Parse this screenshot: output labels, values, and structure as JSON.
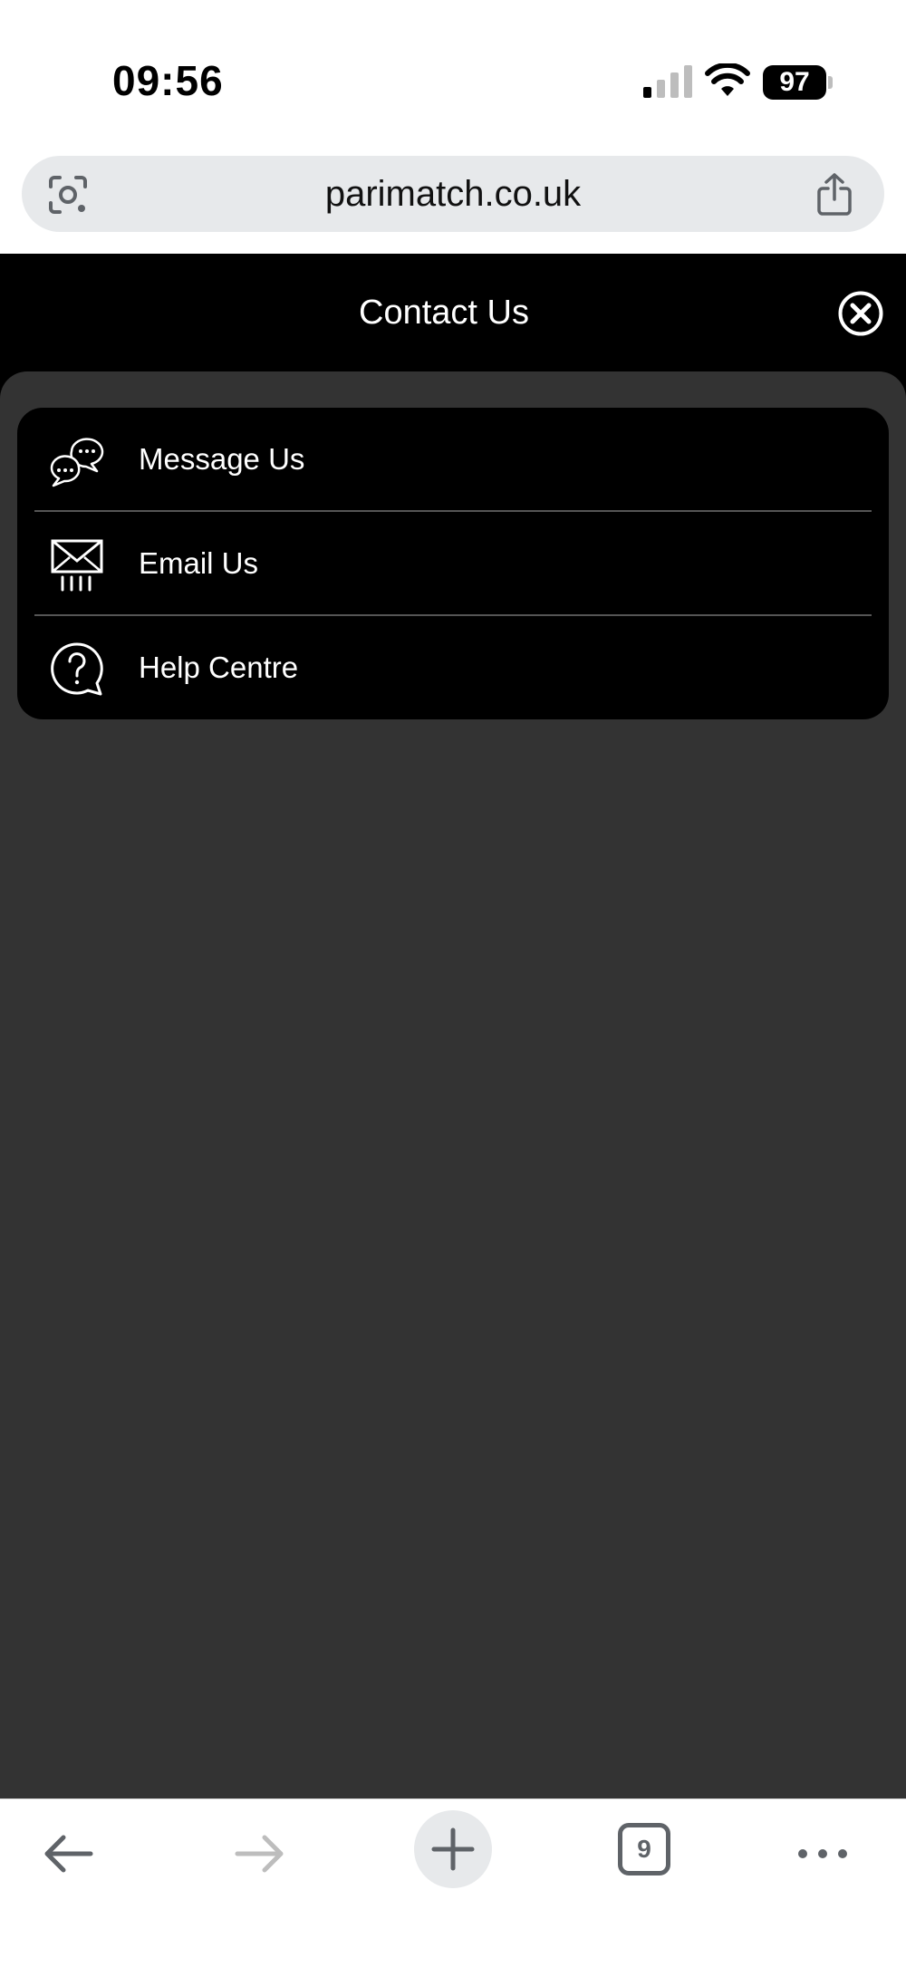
{
  "status_bar": {
    "time": "09:56",
    "battery_level": "97",
    "signal_icon": "cellular-signal-icon",
    "wifi_icon": "wifi-icon"
  },
  "browser": {
    "url": "parimatch.co.uk",
    "lens_icon": "google-lens-icon",
    "share_icon": "share-icon"
  },
  "page": {
    "title": "Contact Us",
    "close_icon": "close-circle-icon"
  },
  "contact_options": [
    {
      "label": "Message Us",
      "icon": "chat-bubbles-icon"
    },
    {
      "label": "Email Us",
      "icon": "envelope-icon"
    },
    {
      "label": "Help Centre",
      "icon": "help-question-icon"
    }
  ],
  "toolbar": {
    "back_icon": "arrow-left-icon",
    "forward_icon": "arrow-right-icon",
    "new_tab_icon": "plus-icon",
    "tab_count": "9",
    "more_icon": "more-horizontal-icon"
  },
  "colors": {
    "header_bg": "#000000",
    "panel_bg": "#333333",
    "card_bg": "#000000",
    "text_light": "#ffffff",
    "url_bar_bg": "#e7e9eb"
  }
}
